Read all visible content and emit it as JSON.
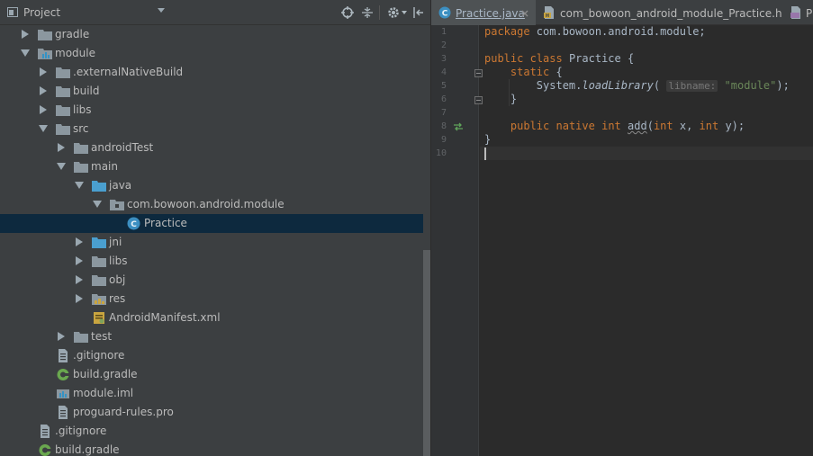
{
  "project_panel": {
    "title": "Project",
    "tree": [
      {
        "label": "gradle",
        "expanded": false,
        "icon": "folder-icon"
      },
      {
        "label": "module",
        "expanded": true,
        "icon": "module-folder-icon"
      },
      {
        "label": ".externalNativeBuild",
        "expanded": false,
        "icon": "folder-icon"
      },
      {
        "label": "build",
        "expanded": false,
        "icon": "folder-icon"
      },
      {
        "label": "libs",
        "expanded": false,
        "icon": "folder-icon"
      },
      {
        "label": "src",
        "expanded": true,
        "icon": "folder-icon"
      },
      {
        "label": "androidTest",
        "expanded": false,
        "icon": "folder-icon"
      },
      {
        "label": "main",
        "expanded": true,
        "icon": "folder-icon"
      },
      {
        "label": "java",
        "expanded": true,
        "icon": "source-folder-icon"
      },
      {
        "label": "com.bowoon.android.module",
        "expanded": true,
        "icon": "package-icon"
      },
      {
        "label": "Practice",
        "icon": "java-class-icon",
        "selected": true
      },
      {
        "label": "jni",
        "expanded": false,
        "icon": "source-folder-icon"
      },
      {
        "label": "libs",
        "expanded": false,
        "icon": "folder-icon"
      },
      {
        "label": "obj",
        "expanded": false,
        "icon": "folder-icon"
      },
      {
        "label": "res",
        "expanded": false,
        "icon": "resource-folder-icon"
      },
      {
        "label": "AndroidManifest.xml",
        "icon": "manifest-icon"
      },
      {
        "label": "test",
        "expanded": false,
        "icon": "folder-icon"
      },
      {
        "label": ".gitignore",
        "icon": "text-file-icon"
      },
      {
        "label": "build.gradle",
        "icon": "gradle-icon"
      },
      {
        "label": "module.iml",
        "icon": "iml-icon"
      },
      {
        "label": "proguard-rules.pro",
        "icon": "text-file-icon"
      },
      {
        "label": ".gitignore",
        "icon": "text-file-icon"
      },
      {
        "label": "build.gradle",
        "icon": "gradle-icon"
      }
    ]
  },
  "editor": {
    "tabs": [
      {
        "label": "Practice.java",
        "active": true,
        "icon": "java-class-icon"
      },
      {
        "label": "com_bowoon_android_module_Practice.h",
        "active": false,
        "icon": "header-file-icon"
      },
      {
        "label": "Pr",
        "active": false,
        "icon": "cpp-file-icon"
      }
    ],
    "line_numbers": [
      "1",
      "2",
      "3",
      "4",
      "5",
      "6",
      "7",
      "8",
      "9",
      "10"
    ],
    "code": {
      "l1_kw": "package",
      "l1_rest": " com.bowoon.android.module;",
      "l3_kw1": "public",
      "l3_kw2": "class",
      "l3_rest": " Practice {",
      "l4_kw": "static",
      "l4_rest": " {",
      "l5_obj": "System.",
      "l5_method": "loadLibrary",
      "l5_paren": "(",
      "l5_hint": "libname:",
      "l5_str": "\"module\"",
      "l5_end": ");",
      "l6": "}",
      "l8_kw1": "public",
      "l8_kw2": "native",
      "l8_kw3": "int",
      "l8_method": "add",
      "l8_paren": "(",
      "l8_kw4": "int",
      "l8_mid": " x, ",
      "l8_kw5": "int",
      "l8_end": " y);",
      "l9": "}"
    }
  },
  "colors": {
    "background": "#2b2b2b",
    "panel": "#3c3f41",
    "selection": "#0d293e",
    "keyword": "#cc7832",
    "string": "#6a8759"
  }
}
